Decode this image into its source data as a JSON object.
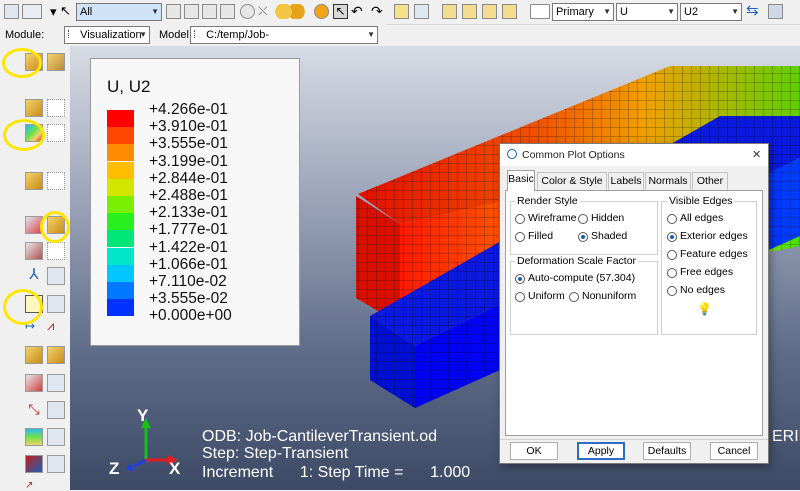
{
  "toolbar": {
    "selection_filter": "All",
    "output_type": "Primary",
    "field_variable": "U",
    "component": "U2"
  },
  "context": {
    "module_label": "Module:",
    "module_value": "Visualization",
    "model_label": "Model:",
    "model_value": "C:/temp/Job-CantileverTransient.odb"
  },
  "legend": {
    "title": "U, U2",
    "entries": [
      {
        "value": "+4.266e-01",
        "color": "#ff0000"
      },
      {
        "value": "+3.910e-01",
        "color": "#ff4600"
      },
      {
        "value": "+3.555e-01",
        "color": "#ff8c00"
      },
      {
        "value": "+3.199e-01",
        "color": "#ffbe00"
      },
      {
        "value": "+2.844e-01",
        "color": "#d2e600"
      },
      {
        "value": "+2.488e-01",
        "color": "#78f000"
      },
      {
        "value": "+2.133e-01",
        "color": "#28f01e"
      },
      {
        "value": "+1.777e-01",
        "color": "#00e678"
      },
      {
        "value": "+1.422e-01",
        "color": "#00e6c8"
      },
      {
        "value": "+1.066e-01",
        "color": "#00c8ff"
      },
      {
        "value": "+7.110e-02",
        "color": "#0078ff"
      },
      {
        "value": "+3.555e-02",
        "color": "#0032ff"
      },
      {
        "value": "+0.000e+00"
      }
    ]
  },
  "viewport_info": {
    "odb_line": "ODB: Job-CantileverTransient.od",
    "odb_tail": "ERIE",
    "step_line": "Step: Step-Transient",
    "increment_line": "Increment      1: Step Time =      1.000"
  },
  "triad": {
    "y": "Y",
    "x": "X",
    "z": "Z"
  },
  "dialog": {
    "title": "Common Plot Options",
    "close_glyph": "✕",
    "tabs": [
      "Basic",
      "Color & Style",
      "Labels",
      "Normals",
      "Other"
    ],
    "render_style": {
      "label": "Render Style",
      "options": [
        "Wireframe",
        "Hidden",
        "Filled",
        "Shaded"
      ],
      "selected": "Shaded"
    },
    "visible_edges": {
      "label": "Visible Edges",
      "options": [
        "All edges",
        "Exterior edges",
        "Feature edges",
        "Free edges",
        "No edges"
      ],
      "selected": "Exterior edges"
    },
    "deformation": {
      "label": "Deformation Scale Factor",
      "auto_label": "Auto-compute",
      "auto_value": "(57.304)",
      "uniform_label": "Uniform",
      "nonuniform_label": "Nonuniform",
      "selected": "Auto-compute"
    },
    "buttons": {
      "ok": "OK",
      "apply": "Apply",
      "defaults": "Defaults",
      "cancel": "Cancel"
    }
  }
}
